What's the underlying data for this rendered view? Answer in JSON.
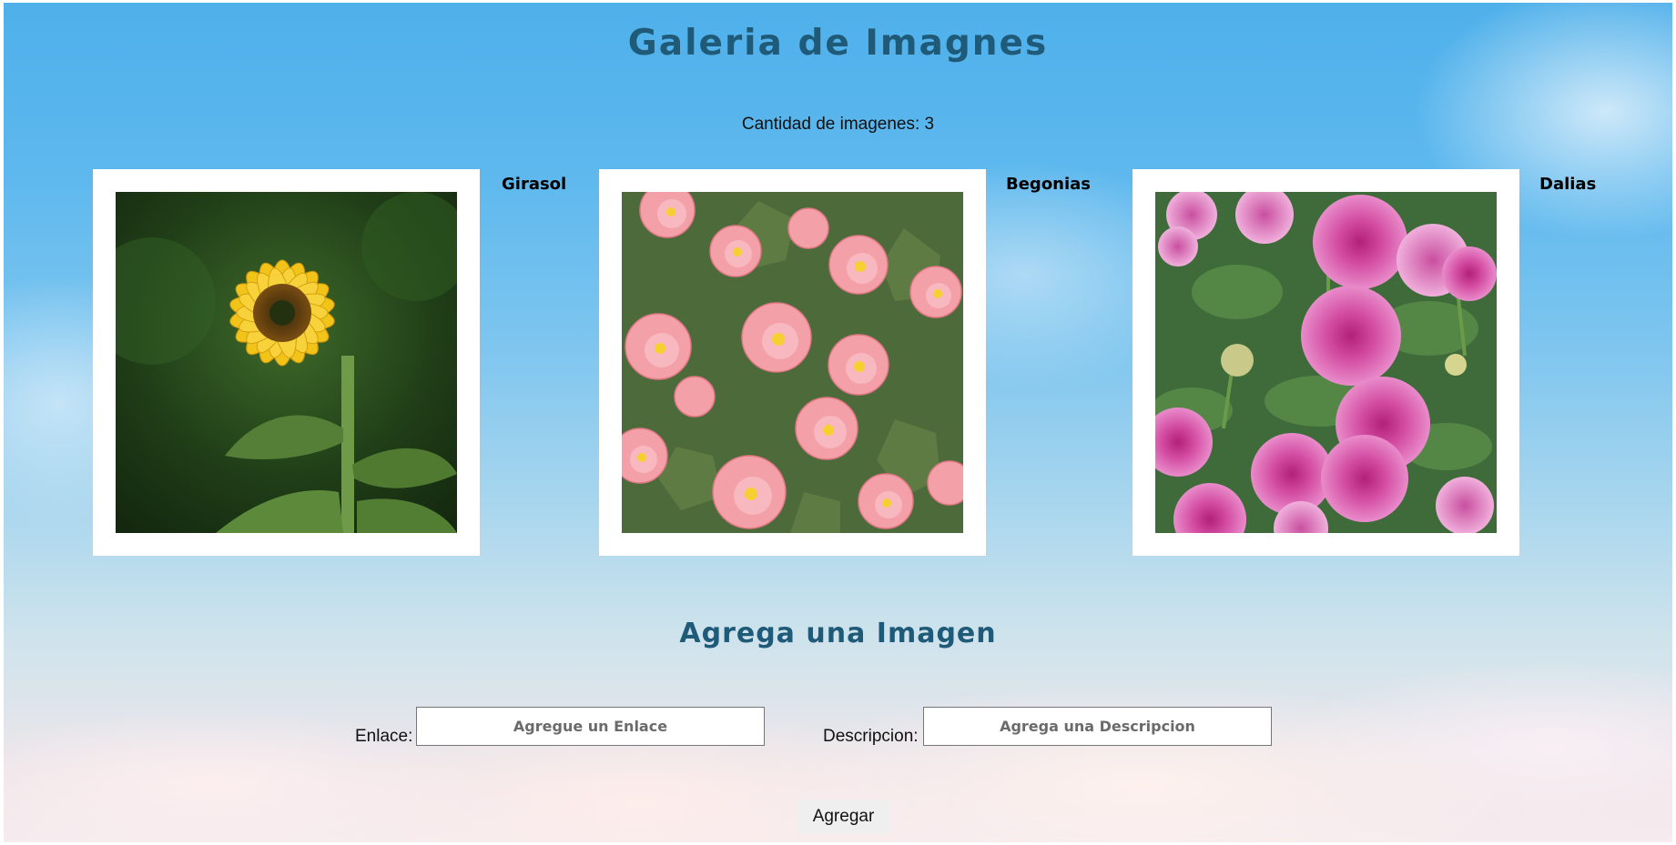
{
  "header": {
    "title": "Galeria de Imagnes",
    "image_count_text": "Cantidad de imagenes: 3"
  },
  "gallery": {
    "items": [
      {
        "name": "Girasol",
        "photo": "sunflower-image"
      },
      {
        "name": "Begonias",
        "photo": "begonia-image"
      },
      {
        "name": "Dalias",
        "photo": "dahlia-image"
      }
    ]
  },
  "form": {
    "heading": "Agrega una Imagen",
    "link_label": "Enlace:",
    "link_placeholder": "Agregue un Enlace",
    "description_label": "Descripcion:",
    "description_placeholder": "Agrega una Descripcion",
    "submit_label": "Agregar"
  },
  "colors": {
    "heading": "#1f5a78",
    "sky_top": "#4fb0ea",
    "cloud_bottom": "#f6ebee"
  }
}
